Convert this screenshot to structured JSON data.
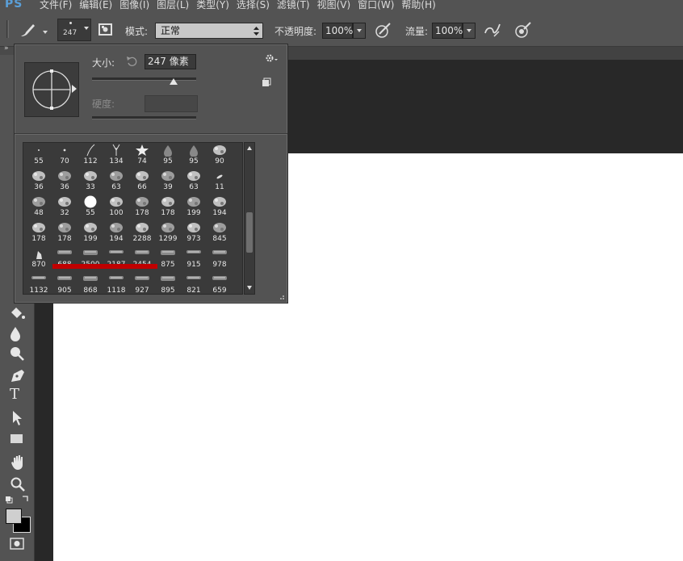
{
  "app": {
    "logo": "PS"
  },
  "menu": [
    "文件(F)",
    "编辑(E)",
    "图像(I)",
    "图层(L)",
    "类型(Y)",
    "选择(S)",
    "滤镜(T)",
    "视图(V)",
    "窗口(W)",
    "帮助(H)"
  ],
  "options": {
    "brush_size": "247",
    "mode_label": "模式:",
    "mode_value": "正常",
    "opacity_label": "不透明度:",
    "opacity_value": "100%",
    "flow_label": "流量:",
    "flow_value": "100%"
  },
  "picker": {
    "size_label": "大小:",
    "size_value": "247 像素",
    "hardness_label": "硬度:",
    "size_slider_fraction": 0.78,
    "brushes": [
      [
        "55",
        "70",
        "112",
        "134",
        "74",
        "95",
        "95",
        "90"
      ],
      [
        "36",
        "36",
        "33",
        "63",
        "66",
        "39",
        "63",
        "11"
      ],
      [
        "48",
        "32",
        "55",
        "100",
        "178",
        "178",
        "199",
        "194"
      ],
      [
        "178",
        "178",
        "199",
        "194",
        "2288",
        "1299",
        "973",
        "845"
      ],
      [
        "870",
        "688",
        "2500",
        "2187",
        "2454",
        "875",
        "915",
        "978"
      ],
      [
        "1132",
        "905",
        "868",
        "1118",
        "927",
        "895",
        "821",
        "659"
      ]
    ]
  },
  "colors": {
    "accent_logo": "#5a9fd8",
    "highlight": "#c00000",
    "canvas": "#ffffff",
    "workspace": "#282828",
    "panel": "#535353"
  }
}
